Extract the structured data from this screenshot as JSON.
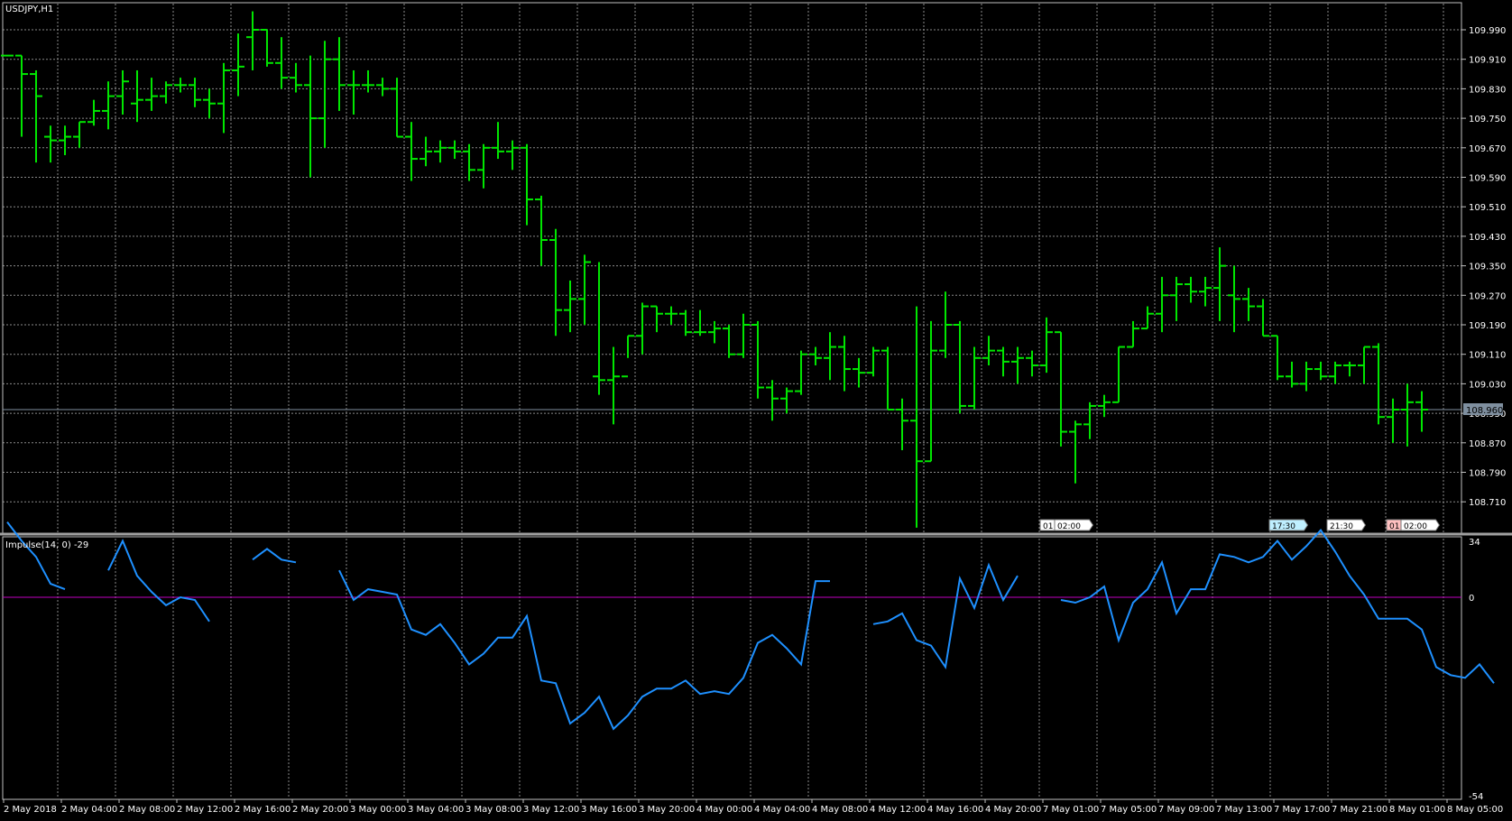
{
  "window": {
    "title": "USDJPY,H1"
  },
  "indicator": {
    "title": "Impulse(14, 0) -29"
  },
  "colors": {
    "background": "#000000",
    "grid": "#8a8a8a",
    "bars": "#00e600",
    "impulse_line": "#1e90ff",
    "zero_line": "#c000c0",
    "current_price_line": "#7f8f9f",
    "frame": "#c0c0c0"
  },
  "chart_data": [
    {
      "type": "bar",
      "subtype": "ohlc",
      "title": "USDJPY,H1",
      "ylim": [
        108.63,
        110.07
      ],
      "yticks": [
        "109.990",
        "109.910",
        "109.830",
        "109.750",
        "109.670",
        "109.590",
        "109.510",
        "109.430",
        "109.350",
        "109.270",
        "109.190",
        "109.110",
        "109.030",
        "108.950",
        "108.870",
        "108.790",
        "108.710"
      ],
      "current_price": "108.960",
      "xticks": [
        "2 May 2018",
        "2 May 04:00",
        "2 May 08:00",
        "2 May 12:00",
        "2 May 16:00",
        "2 May 20:00",
        "3 May 00:00",
        "3 May 04:00",
        "3 May 08:00",
        "3 May 12:00",
        "3 May 16:00",
        "3 May 20:00",
        "4 May 00:00",
        "4 May 04:00",
        "4 May 08:00",
        "4 May 12:00",
        "4 May 16:00",
        "4 May 20:00",
        "7 May 01:00",
        "7 May 05:00",
        "7 May 09:00",
        "7 May 13:00",
        "7 May 17:00",
        "7 May 21:00",
        "8 May 01:00",
        "8 May 05:00"
      ],
      "grid": true,
      "ohlc": [
        [
          109.92,
          109.92,
          109.92,
          109.92
        ],
        [
          109.92,
          109.92,
          109.7,
          109.87
        ],
        [
          109.87,
          109.88,
          109.63,
          109.81
        ],
        [
          109.7,
          109.73,
          109.63,
          109.69
        ],
        [
          109.69,
          109.73,
          109.65,
          109.7
        ],
        [
          109.7,
          109.74,
          109.67,
          109.74
        ],
        [
          109.74,
          109.8,
          109.73,
          109.77
        ],
        [
          109.77,
          109.85,
          109.72,
          109.81
        ],
        [
          109.81,
          109.88,
          109.76,
          109.85
        ],
        [
          109.79,
          109.88,
          109.74,
          109.8
        ],
        [
          109.8,
          109.86,
          109.77,
          109.81
        ],
        [
          109.81,
          109.85,
          109.79,
          109.84
        ],
        [
          109.84,
          109.86,
          109.82,
          109.84
        ],
        [
          109.84,
          109.86,
          109.78,
          109.8
        ],
        [
          109.8,
          109.83,
          109.75,
          109.79
        ],
        [
          109.79,
          109.9,
          109.71,
          109.88
        ],
        [
          109.88,
          109.98,
          109.81,
          109.89
        ],
        [
          109.97,
          110.04,
          109.88,
          109.99
        ],
        [
          109.99,
          109.99,
          109.89,
          109.9
        ],
        [
          109.9,
          109.97,
          109.83,
          109.86
        ],
        [
          109.86,
          109.9,
          109.82,
          109.84
        ],
        [
          109.84,
          109.92,
          109.59,
          109.75
        ],
        [
          109.75,
          109.96,
          109.67,
          109.91
        ],
        [
          109.91,
          109.97,
          109.77,
          109.84
        ],
        [
          109.84,
          109.88,
          109.76,
          109.84
        ],
        [
          109.84,
          109.88,
          109.82,
          109.84
        ],
        [
          109.84,
          109.86,
          109.81,
          109.83
        ],
        [
          109.83,
          109.86,
          109.7,
          109.7
        ],
        [
          109.7,
          109.74,
          109.58,
          109.64
        ],
        [
          109.64,
          109.7,
          109.62,
          109.66
        ],
        [
          109.66,
          109.69,
          109.63,
          109.67
        ],
        [
          109.67,
          109.69,
          109.64,
          109.66
        ],
        [
          109.66,
          109.68,
          109.58,
          109.61
        ],
        [
          109.61,
          109.68,
          109.56,
          109.67
        ],
        [
          109.67,
          109.74,
          109.64,
          109.66
        ],
        [
          109.66,
          109.69,
          109.61,
          109.67
        ],
        [
          109.67,
          109.68,
          109.46,
          109.53
        ],
        [
          109.53,
          109.54,
          109.35,
          109.42
        ],
        [
          109.42,
          109.45,
          109.16,
          109.23
        ],
        [
          109.23,
          109.31,
          109.17,
          109.26
        ],
        [
          109.26,
          109.38,
          109.19,
          109.36
        ],
        [
          109.05,
          109.36,
          109.0,
          109.04
        ],
        [
          109.04,
          109.13,
          108.92,
          109.05
        ],
        [
          109.05,
          109.16,
          109.1,
          109.16
        ],
        [
          109.16,
          109.25,
          109.11,
          109.24
        ],
        [
          109.24,
          109.24,
          109.17,
          109.22
        ],
        [
          109.22,
          109.24,
          109.19,
          109.22
        ],
        [
          109.22,
          109.23,
          109.16,
          109.17
        ],
        [
          109.17,
          109.23,
          109.16,
          109.17
        ],
        [
          109.17,
          109.2,
          109.14,
          109.18
        ],
        [
          109.18,
          109.19,
          109.1,
          109.11
        ],
        [
          109.11,
          109.22,
          109.1,
          109.19
        ],
        [
          109.19,
          109.2,
          108.99,
          109.02
        ],
        [
          109.02,
          109.04,
          108.93,
          108.99
        ],
        [
          108.99,
          109.02,
          108.95,
          109.01
        ],
        [
          109.01,
          109.12,
          109.0,
          109.11
        ],
        [
          109.11,
          109.13,
          109.08,
          109.1
        ],
        [
          109.1,
          109.17,
          109.04,
          109.13
        ],
        [
          109.13,
          109.16,
          109.01,
          109.07
        ],
        [
          109.07,
          109.1,
          109.02,
          109.06
        ],
        [
          109.06,
          109.13,
          109.05,
          109.12
        ],
        [
          109.12,
          109.13,
          108.96,
          108.96
        ],
        [
          108.96,
          108.99,
          108.85,
          108.93
        ],
        [
          108.93,
          109.24,
          108.64,
          108.82
        ],
        [
          108.82,
          109.2,
          108.82,
          109.12
        ],
        [
          109.12,
          109.28,
          109.1,
          109.19
        ],
        [
          109.19,
          109.2,
          108.95,
          108.97
        ],
        [
          108.97,
          109.13,
          108.96,
          109.1
        ],
        [
          109.1,
          109.16,
          109.08,
          109.12
        ],
        [
          109.12,
          109.13,
          109.05,
          109.09
        ],
        [
          109.09,
          109.13,
          109.03,
          109.1
        ],
        [
          109.1,
          109.12,
          109.05,
          109.08
        ],
        [
          109.08,
          109.21,
          109.06,
          109.17
        ],
        [
          109.17,
          109.17,
          108.86,
          108.9
        ],
        [
          108.9,
          108.93,
          108.76,
          108.92
        ],
        [
          108.92,
          108.98,
          108.88,
          108.97
        ],
        [
          108.97,
          109.0,
          108.94,
          108.98
        ],
        [
          108.98,
          109.13,
          108.98,
          109.13
        ],
        [
          109.13,
          109.2,
          109.13,
          109.18
        ],
        [
          109.18,
          109.24,
          109.18,
          109.22
        ],
        [
          109.22,
          109.32,
          109.17,
          109.27
        ],
        [
          109.27,
          109.32,
          109.2,
          109.3
        ],
        [
          109.3,
          109.32,
          109.25,
          109.28
        ],
        [
          109.28,
          109.32,
          109.24,
          109.29
        ],
        [
          109.29,
          109.4,
          109.2,
          109.35
        ],
        [
          109.27,
          109.35,
          109.17,
          109.26
        ],
        [
          109.26,
          109.29,
          109.2,
          109.24
        ],
        [
          109.24,
          109.26,
          109.16,
          109.16
        ],
        [
          109.16,
          109.16,
          109.04,
          109.05
        ],
        [
          109.05,
          109.09,
          109.02,
          109.03
        ],
        [
          109.03,
          109.09,
          109.01,
          109.07
        ],
        [
          109.07,
          109.09,
          109.04,
          109.05
        ],
        [
          109.05,
          109.09,
          109.03,
          109.08
        ],
        [
          109.08,
          109.09,
          109.05,
          109.08
        ],
        [
          109.08,
          109.13,
          109.03,
          109.13
        ],
        [
          109.13,
          109.14,
          108.92,
          108.94
        ],
        [
          108.94,
          108.99,
          108.87,
          108.96
        ],
        [
          108.96,
          109.03,
          108.86,
          108.98
        ],
        [
          108.98,
          109.01,
          108.9,
          108.96
        ]
      ]
    },
    {
      "type": "line",
      "title": "Impulse(14, 0) -29",
      "ylim": [
        -54,
        34
      ],
      "yticks": [
        "34",
        "0",
        "-54"
      ],
      "zero_line": 0,
      "series": [
        {
          "values": [
            28,
            21,
            15,
            5,
            3,
            null,
            null,
            10,
            21,
            8,
            2,
            -3,
            0,
            -1,
            -9,
            null,
            null,
            14,
            18,
            14,
            13,
            null,
            null,
            10,
            -1,
            3,
            2,
            1,
            -12,
            -14,
            -10,
            -17,
            -25,
            -21,
            -15,
            -15,
            -7,
            -31,
            -32,
            -47,
            -43,
            -37,
            -49,
            -44,
            -37,
            -34,
            -34,
            -31,
            -36,
            -35,
            -36,
            -30,
            -17,
            -14,
            -19,
            -25,
            6,
            6,
            null,
            null,
            -10,
            -9,
            -6,
            -16,
            -18,
            -26,
            7,
            -4,
            12,
            -1,
            8,
            null,
            null,
            -1,
            -2,
            0,
            4,
            -16,
            -2,
            3,
            13,
            -6,
            3,
            3,
            16,
            15,
            13,
            15,
            21,
            14,
            19,
            25,
            17,
            8,
            1,
            -8,
            -8,
            -8,
            -12,
            -26,
            -29,
            -30,
            -25,
            -32
          ]
        }
      ]
    }
  ],
  "time_markers": [
    {
      "label": "01:",
      "color": "#ffffff"
    },
    {
      "label": "02:00",
      "color": "#ffffff"
    },
    {
      "label": "17:30",
      "color": "#bfefff"
    },
    {
      "label": "21:30",
      "color": "#ffffff"
    },
    {
      "label": "01:",
      "color": "#ffc0c0"
    },
    {
      "label": "02:00",
      "color": "#ffffff"
    }
  ]
}
